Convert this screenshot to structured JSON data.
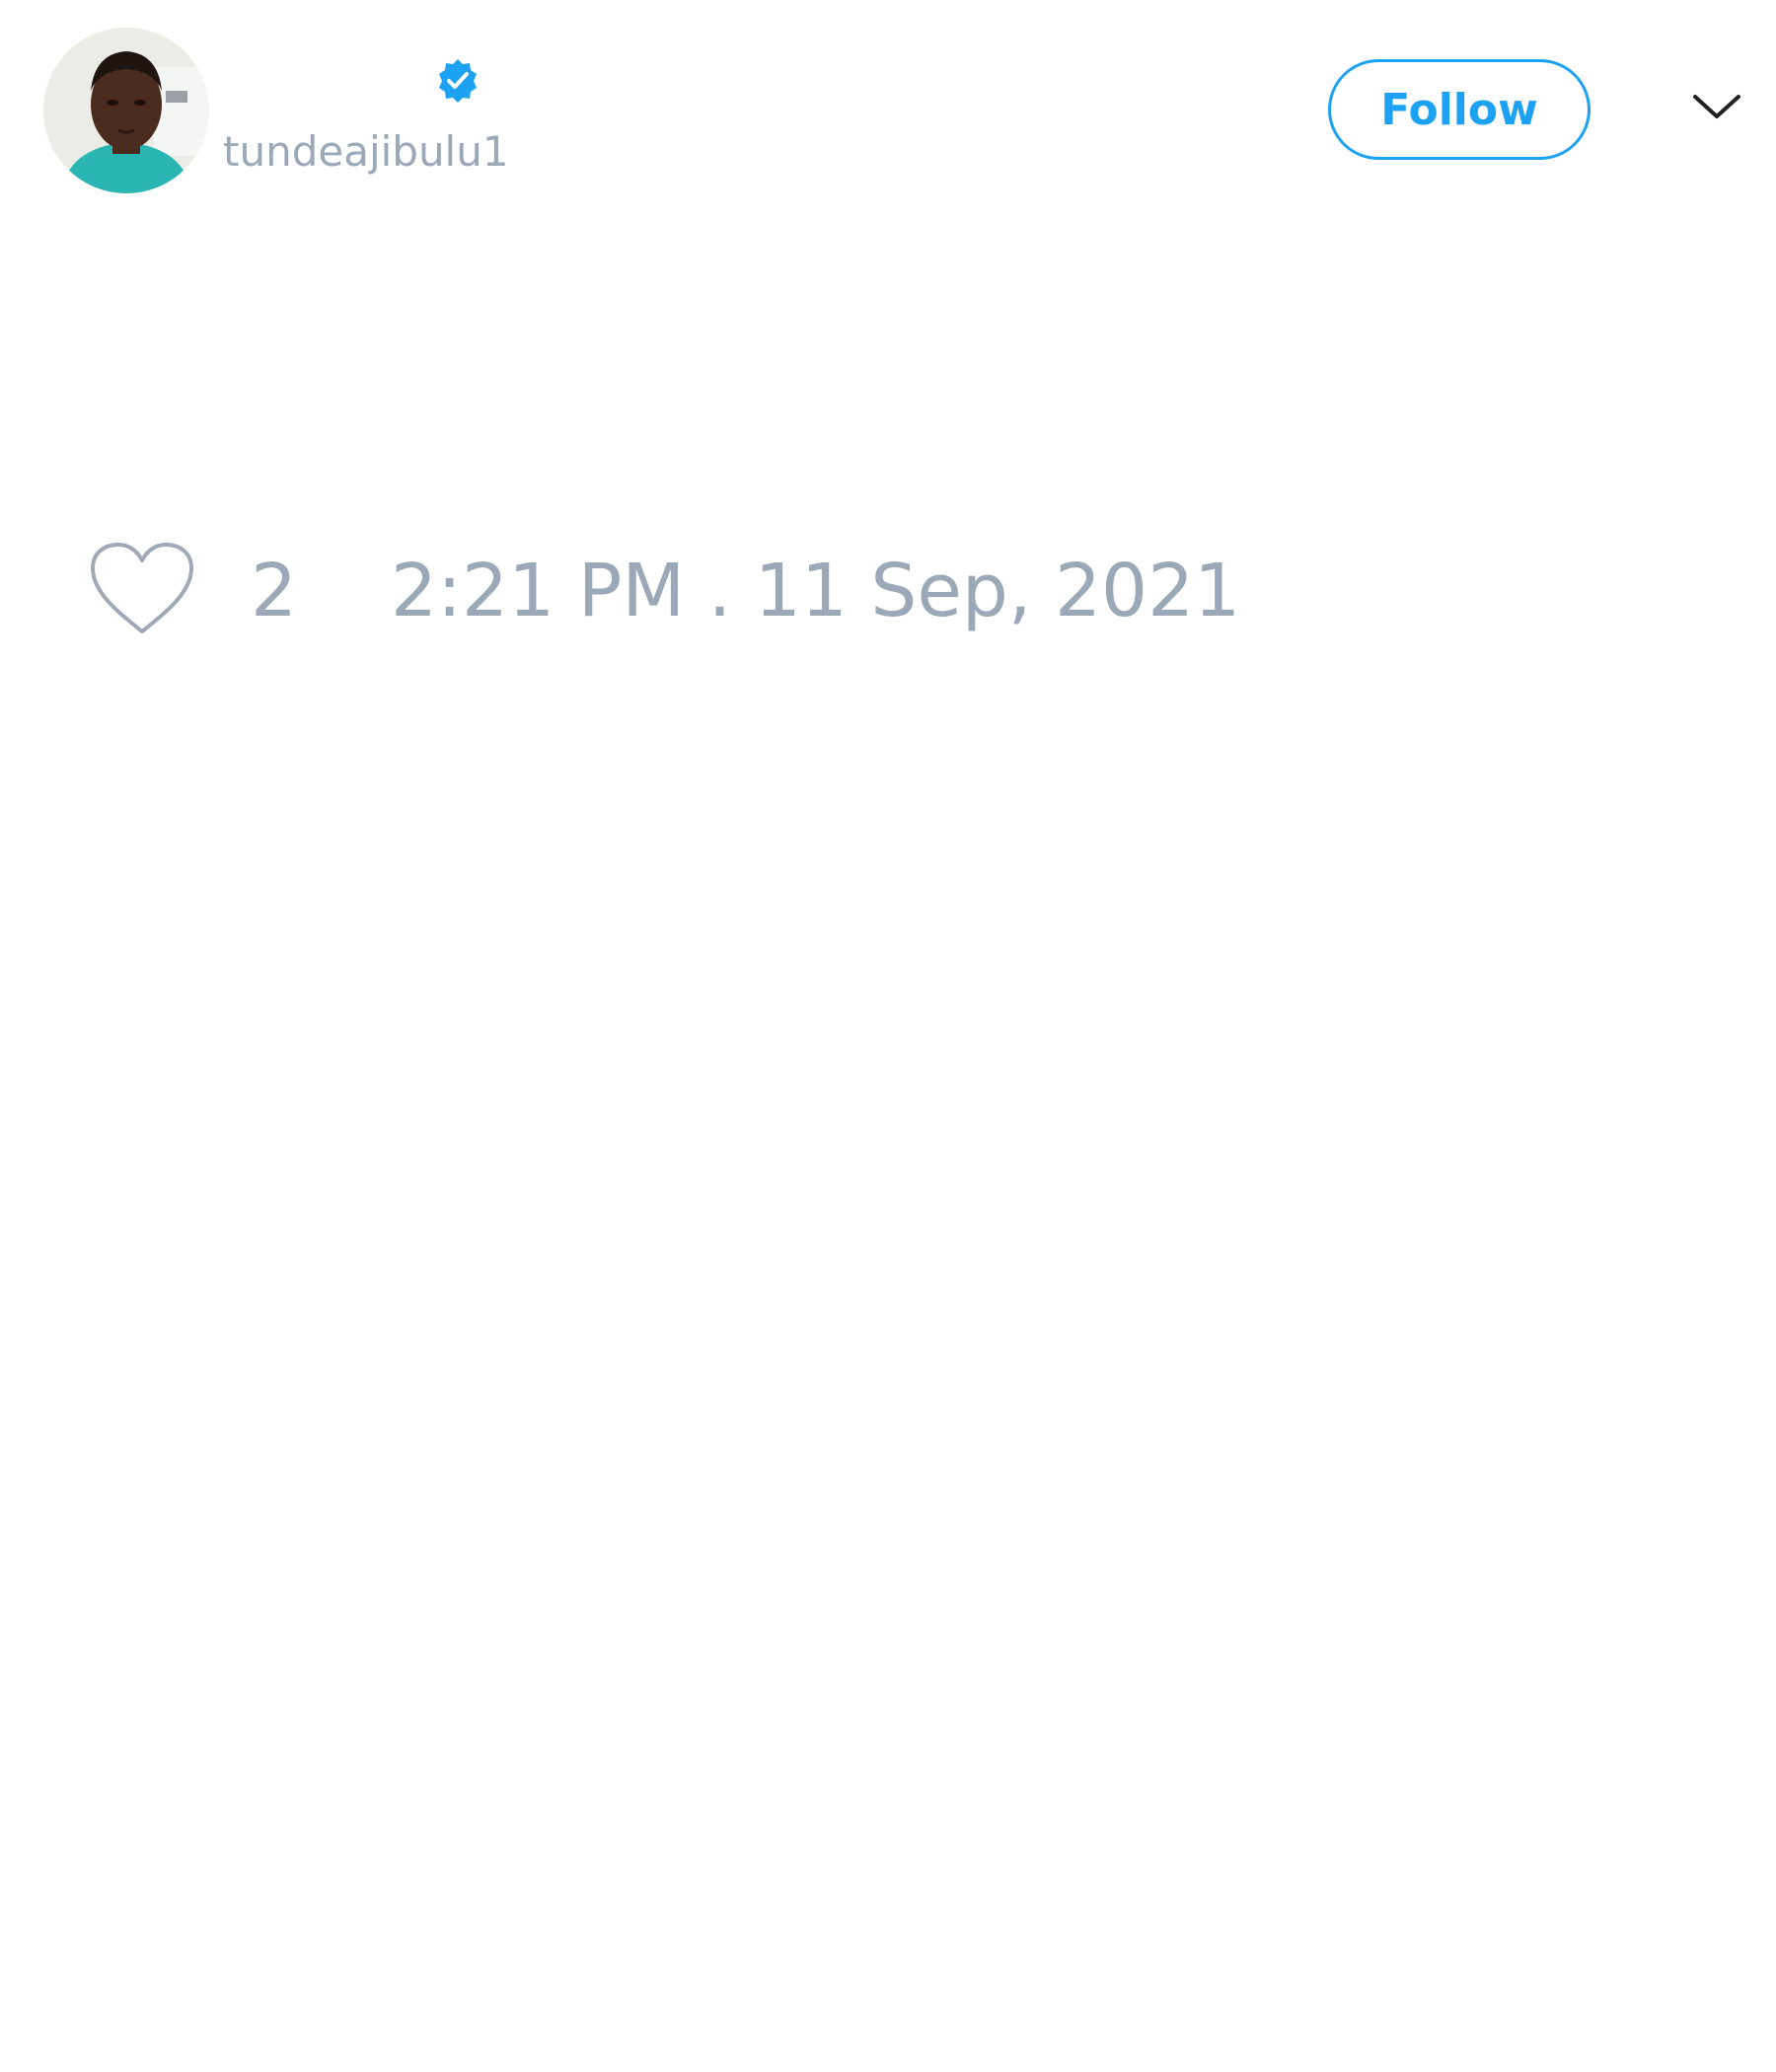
{
  "author": {
    "handle": "tundeajibulu1",
    "verified": true
  },
  "actions": {
    "follow_label": "Follow"
  },
  "tweet": {
    "like_count": "2",
    "timestamp": "2:21 PM . 11 Sep, 2021"
  },
  "icons": {
    "avatar": "profile-photo",
    "verified": "verified-badge-icon",
    "menu": "chevron-down-icon",
    "like": "heart-icon"
  },
  "colors": {
    "accent": "#1da1f2",
    "muted_text": "#9aa8b8",
    "background": "#ffffff"
  }
}
